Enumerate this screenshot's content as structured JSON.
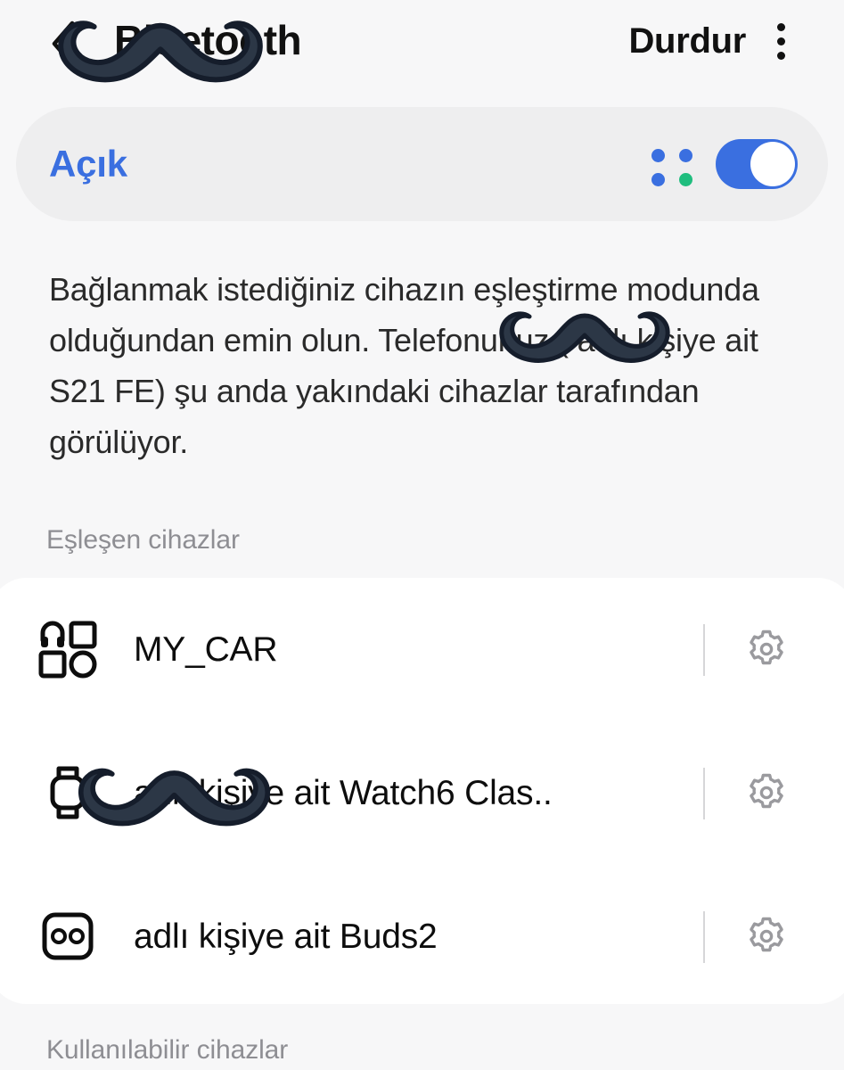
{
  "header": {
    "back_icon": "chevron-left-icon",
    "title": "Bluetooth",
    "action_label": "Durdur",
    "overflow_icon": "more-vertical-icon"
  },
  "toggle_row": {
    "status_label": "Açık",
    "status_color": "#3a6fe0",
    "scanning_indicator_icon": "scanning-dots-icon",
    "scanning_dot_colors": [
      "#3a6fe0",
      "#3a6fe0",
      "#3a6fe0",
      "#1fbd7e"
    ],
    "switch_state": "on",
    "switch_color": "#3a6fe0"
  },
  "description": "Bağlanmak istediğiniz cihazın eşleştirme modunda olduğundan emin olun. Telefonunuz ( adlı kişiye ait S21 FE) şu anda yakındaki cihazlar tarafından görülüyor.",
  "sections": {
    "paired_label": "Eşleşen cihazlar",
    "available_label": "Kullanılabilir cihazlar"
  },
  "paired_devices": [
    {
      "name": "MY_CAR",
      "icon": "generic-device-icon",
      "settings_icon": "gear-icon",
      "redacted": false
    },
    {
      "name": "adlı kişiye ait Watch6 Clas..",
      "icon": "watch-icon",
      "settings_icon": "gear-icon",
      "redacted": true
    },
    {
      "name": "adlı kişiye ait Buds2",
      "icon": "buds-icon",
      "settings_icon": "gear-icon",
      "redacted": true
    }
  ],
  "stickers": {
    "type": "mustache-sticker",
    "color": "#2c3746",
    "outline_color": "#151d2b",
    "count": 3
  },
  "colors": {
    "page_background": "#f7f7f8",
    "card_background": "#ffffff",
    "pill_background": "#eeeeef",
    "accent": "#3a6fe0",
    "muted_text": "#8e8e93",
    "body_text": "#2a2a2a"
  }
}
